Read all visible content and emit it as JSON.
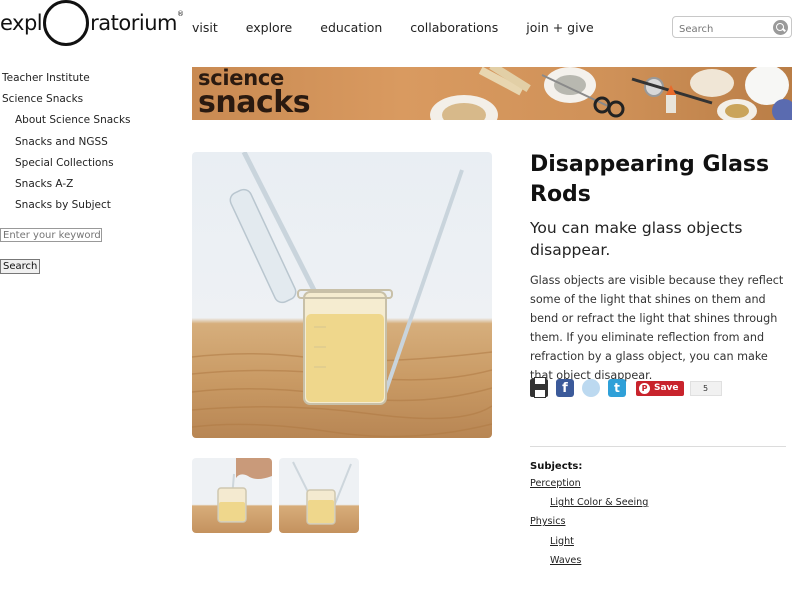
{
  "header": {
    "logo": {
      "pre": "expl",
      "post": "ratorium",
      "mark": "®"
    },
    "nav": [
      "visit",
      "explore",
      "education",
      "collaborations",
      "join + give"
    ],
    "search_placeholder": "Search"
  },
  "sidebar": {
    "items": [
      {
        "label": "Teacher Institute",
        "level": 0
      },
      {
        "label": "Science Snacks",
        "level": 0
      },
      {
        "label": "About Science Snacks",
        "level": 1
      },
      {
        "label": "Snacks and NGSS",
        "level": 1
      },
      {
        "label": "Special Collections",
        "level": 1
      },
      {
        "label": "Snacks A-Z",
        "level": 1
      },
      {
        "label": "Snacks by Subject",
        "level": 1
      }
    ],
    "keyword_placeholder": "Enter your keywords",
    "search_button": "Search"
  },
  "banner": {
    "line1": "science",
    "line2": "snacks"
  },
  "article": {
    "title": "Disappearing Glass Rods",
    "subtitle": "You can make glass objects disappear.",
    "body": "Glass objects are visible because they reflect some of the light that shines on them and bend or refract the light that shines through them. If you eliminate reflection from and refraction by a glass object, you can make that object disappear."
  },
  "share": {
    "pin_label": "Save",
    "pin_count": "5",
    "icons": [
      "print-icon",
      "facebook-icon",
      "reddit-icon",
      "twitter-icon"
    ]
  },
  "subjects": {
    "heading": "Subjects:",
    "items": [
      {
        "label": "Perception",
        "level": 0
      },
      {
        "label": "Light Color & Seeing",
        "level": 1
      },
      {
        "label": "Physics",
        "level": 0
      },
      {
        "label": "Light",
        "level": 1
      },
      {
        "label": "Waves",
        "level": 1
      }
    ]
  },
  "colors": {
    "banner_bg": "#cf9158",
    "pinterest": "#c8232c",
    "facebook": "#3b5a9a",
    "twitter": "#2fa0d8"
  }
}
